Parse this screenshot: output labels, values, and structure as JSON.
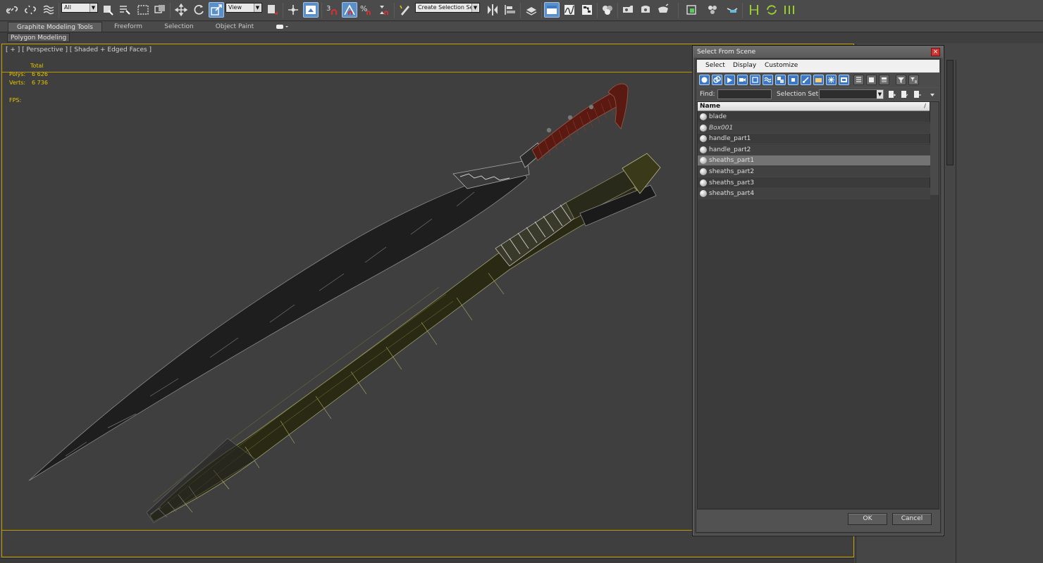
{
  "toolbar": {
    "filter_dropdown": "All",
    "coord_dropdown": "View",
    "snap_label": "3",
    "selection_set_dropdown": "Create Selection Se"
  },
  "ribbon": {
    "tabs": [
      {
        "label": "Graphite Modeling Tools"
      },
      {
        "label": "Freeform"
      },
      {
        "label": "Selection"
      },
      {
        "label": "Object Paint"
      }
    ],
    "panel_label": "Polygon Modeling"
  },
  "viewport": {
    "label": "[ + ] [ Perspective ] [ Shaded + Edged Faces ]",
    "stats": {
      "total_label": "Total",
      "polys_label": "Polys:",
      "polys_value": "6 626",
      "verts_label": "Verts:",
      "verts_value": "6 736",
      "fps_label": "FPS:"
    }
  },
  "dialog": {
    "title": "Select From Scene",
    "close_glyph": "×",
    "menu": [
      "Select",
      "Display",
      "Customize"
    ],
    "find_label": "Find:",
    "find_value": "",
    "selection_set_label": "Selection Set:",
    "selection_set_value": "",
    "column_name": "Name",
    "sort_glyph": "/",
    "items": [
      {
        "name": "blade",
        "italic": false,
        "selected": false
      },
      {
        "name": "Box001",
        "italic": true,
        "selected": false
      },
      {
        "name": "handle_part1",
        "italic": false,
        "selected": false
      },
      {
        "name": "handle_part2",
        "italic": false,
        "selected": false
      },
      {
        "name": "sheaths_part1",
        "italic": false,
        "selected": true
      },
      {
        "name": "sheaths_part2",
        "italic": false,
        "selected": false
      },
      {
        "name": "sheaths_part3",
        "italic": false,
        "selected": false
      },
      {
        "name": "sheaths_part4",
        "italic": false,
        "selected": false
      }
    ],
    "ok_label": "OK",
    "cancel_label": "Cancel"
  },
  "colors": {
    "accent": "#3d78c6",
    "viewport_border": "#c4a000",
    "stats_text": "#e6c400"
  }
}
